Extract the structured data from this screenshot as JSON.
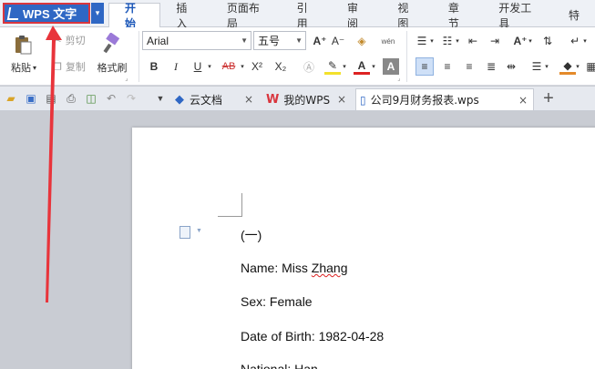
{
  "app": {
    "title": "WPS 文字",
    "dropdown_symbol": "▾"
  },
  "menu_tabs": [
    "开始",
    "插入",
    "页面布局",
    "引用",
    "审阅",
    "视图",
    "章节",
    "开发工具",
    "特"
  ],
  "active_tab": "开始",
  "ribbon": {
    "paste_label": "粘贴",
    "cut_label": "剪切",
    "copy_label": "复制",
    "format_painter_label": "格式刷",
    "font_name": "Arial",
    "font_size": "五号",
    "bold_glyph": "B",
    "italic_glyph": "I",
    "underline_glyph": "U",
    "strike_glyph": "AB",
    "superscript_glyph": "X²",
    "subscript_glyph": "X₂",
    "grow_font_glyph": "A⁺",
    "shrink_font_glyph": "A⁻",
    "font_color_glyph": "A",
    "phonetic_glyph": "wén"
  },
  "doc_tabs": [
    {
      "label": "云文档",
      "icon": "cloud-docs-icon",
      "close": "×"
    },
    {
      "label": "我的WPS",
      "icon": "wps-logo-icon",
      "close": "×"
    },
    {
      "label": "公司9月财务报表.wps",
      "icon": "document-icon",
      "close": "×"
    }
  ],
  "new_tab_symbol": "+",
  "document": {
    "lines": [
      "(一)",
      "Name: Miss ",
      "Zhang",
      "Sex: Female",
      "Date of Birth: 1982-04-28",
      "National: Han"
    ]
  },
  "colors": {
    "app_button_bg": "#2f67c4",
    "highlight_border": "#d9363e",
    "arrow": "#e8343b",
    "active_tab_text": "#1a56b8",
    "workspace_bg": "#c9ccd3"
  }
}
